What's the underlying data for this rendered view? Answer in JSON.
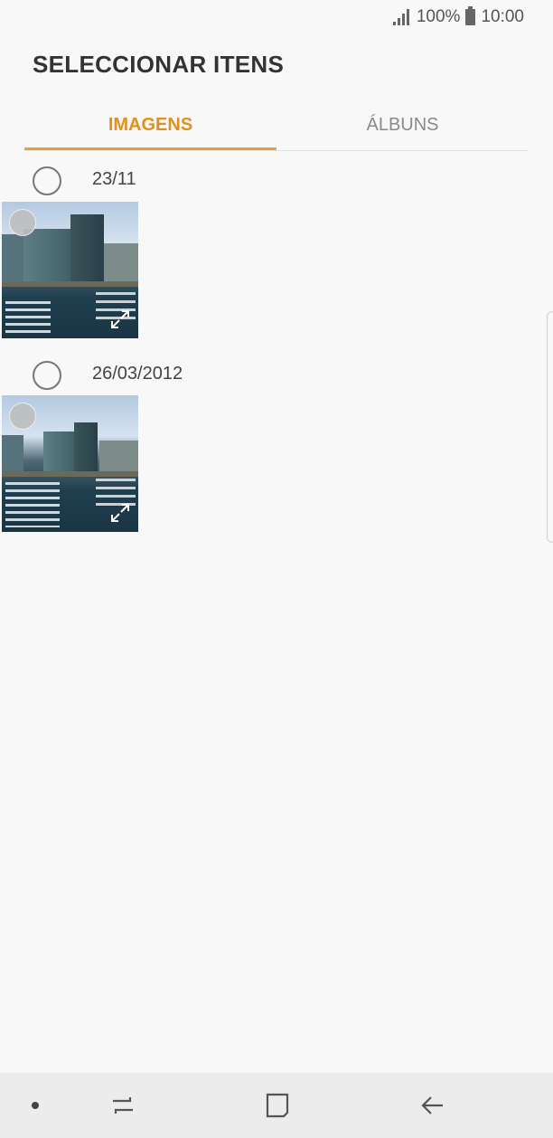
{
  "status_bar": {
    "battery_text": "100%",
    "time": "10:00",
    "icons": [
      "signal-icon",
      "battery-icon"
    ]
  },
  "page": {
    "title": "SELECCIONAR ITENS"
  },
  "tabs": [
    {
      "label": "IMAGENS",
      "selected": true
    },
    {
      "label": "ÁLBUNS",
      "selected": false
    }
  ],
  "groups": [
    {
      "date": "23/11",
      "items": [
        {
          "type": "image",
          "icon": "expand-icon"
        }
      ]
    },
    {
      "date": "26/03/2012",
      "items": [
        {
          "type": "image",
          "icon": "expand-icon"
        }
      ]
    }
  ],
  "nav_bar": {
    "icons": [
      "nav-dot-icon",
      "recent-apps-icon",
      "home-icon",
      "back-icon"
    ]
  },
  "colors": {
    "accent": "#e8a13a",
    "background": "#f8f8f8",
    "nav_background": "#ececec"
  }
}
